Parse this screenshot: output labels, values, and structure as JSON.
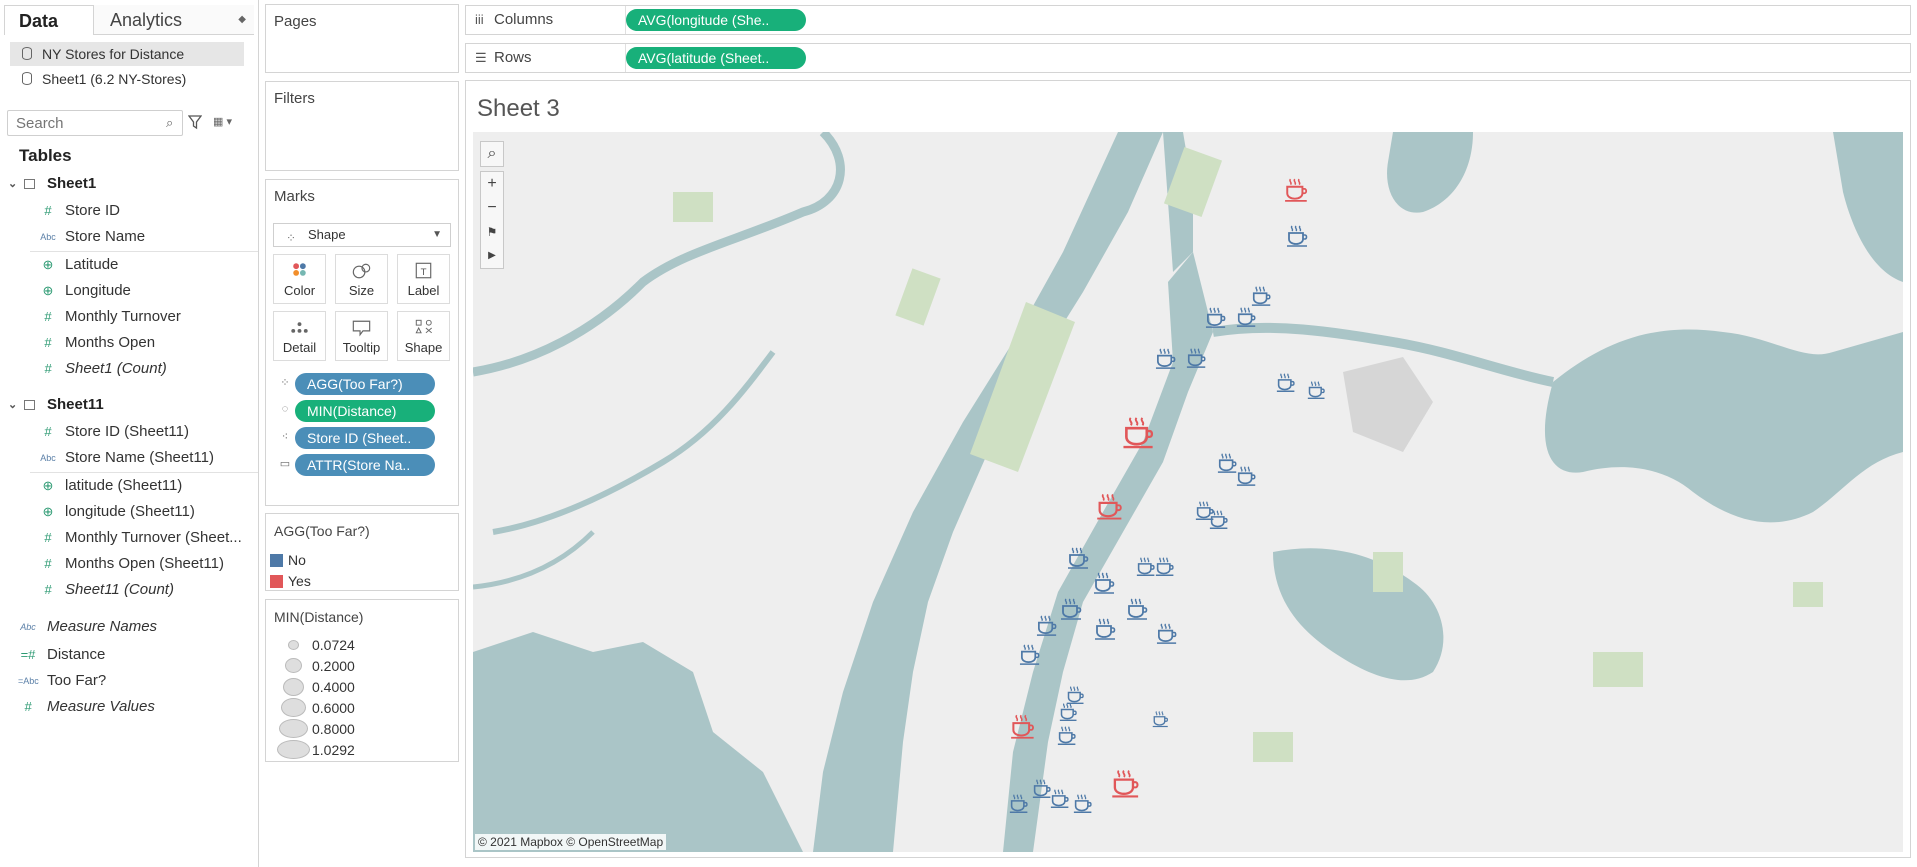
{
  "left_pane": {
    "tabs": {
      "data": "Data",
      "analytics": "Analytics"
    },
    "datasources": [
      "NY Stores for Distance",
      "Sheet1 (6.2 NY-Stores)"
    ],
    "search_placeholder": "Search",
    "tables_header": "Tables",
    "sheet1": {
      "name": "Sheet1",
      "fields": [
        "Store ID",
        "Store Name",
        "Latitude",
        "Longitude",
        "Monthly Turnover",
        "Months Open",
        "Sheet1 (Count)"
      ]
    },
    "sheet11": {
      "name": "Sheet11",
      "fields": [
        "Store ID (Sheet11)",
        "Store Name (Sheet11)",
        "latitude (Sheet11)",
        "longitude (Sheet11)",
        "Monthly Turnover (Sheet...",
        "Months Open (Sheet11)",
        "Sheet11 (Count)"
      ]
    },
    "extra_fields": [
      "Measure Names",
      "Distance",
      "Too Far?",
      "Measure Values"
    ]
  },
  "pages_card": {
    "title": "Pages"
  },
  "filters_card": {
    "title": "Filters"
  },
  "marks": {
    "title": "Marks",
    "mark_type": "Shape",
    "buttons": [
      "Color",
      "Size",
      "Label",
      "Detail",
      "Tooltip",
      "Shape"
    ],
    "pills": [
      "AGG(Too Far?)",
      "MIN(Distance)",
      "Store ID (Sheet..",
      "ATTR(Store Na.."
    ]
  },
  "color_legend": {
    "title": "AGG(Too Far?)",
    "items": [
      {
        "label": "No",
        "color": "#4e79a7"
      },
      {
        "label": "Yes",
        "color": "#e15759"
      }
    ]
  },
  "size_legend": {
    "title": "MIN(Distance)",
    "items": [
      "0.0724",
      "0.2000",
      "0.4000",
      "0.6000",
      "0.8000",
      "1.0292"
    ]
  },
  "shelves": {
    "columns_label": "Columns",
    "columns_pill": "AVG(longitude (She..",
    "rows_label": "Rows",
    "rows_pill": "AVG(latitude (Sheet.."
  },
  "sheet": {
    "title": "Sheet 3",
    "attribution": "© 2021 Mapbox © OpenStreetMap"
  },
  "map_marks": [
    {
      "lon": 0.576,
      "lat": 0.08,
      "too_far": true,
      "size": 0.55
    },
    {
      "lon": 0.577,
      "lat": 0.144,
      "too_far": false,
      "size": 0.45
    },
    {
      "lon": 0.552,
      "lat": 0.228,
      "too_far": false,
      "size": 0.35
    },
    {
      "lon": 0.52,
      "lat": 0.257,
      "too_far": false,
      "size": 0.4
    },
    {
      "lon": 0.541,
      "lat": 0.257,
      "too_far": false,
      "size": 0.35
    },
    {
      "lon": 0.485,
      "lat": 0.314,
      "too_far": false,
      "size": 0.4
    },
    {
      "lon": 0.506,
      "lat": 0.314,
      "too_far": false,
      "size": 0.35
    },
    {
      "lon": 0.569,
      "lat": 0.348,
      "too_far": false,
      "size": 0.3
    },
    {
      "lon": 0.59,
      "lat": 0.358,
      "too_far": false,
      "size": 0.25
    },
    {
      "lon": 0.466,
      "lat": 0.417,
      "too_far": true,
      "size": 0.95
    },
    {
      "lon": 0.528,
      "lat": 0.46,
      "too_far": false,
      "size": 0.35
    },
    {
      "lon": 0.541,
      "lat": 0.478,
      "too_far": false,
      "size": 0.35
    },
    {
      "lon": 0.446,
      "lat": 0.52,
      "too_far": true,
      "size": 0.7
    },
    {
      "lon": 0.512,
      "lat": 0.525,
      "too_far": false,
      "size": 0.3
    },
    {
      "lon": 0.522,
      "lat": 0.538,
      "too_far": false,
      "size": 0.3
    },
    {
      "lon": 0.424,
      "lat": 0.591,
      "too_far": false,
      "size": 0.45
    },
    {
      "lon": 0.471,
      "lat": 0.603,
      "too_far": false,
      "size": 0.3
    },
    {
      "lon": 0.484,
      "lat": 0.603,
      "too_far": false,
      "size": 0.3
    },
    {
      "lon": 0.442,
      "lat": 0.627,
      "too_far": false,
      "size": 0.45
    },
    {
      "lon": 0.465,
      "lat": 0.663,
      "too_far": false,
      "size": 0.45
    },
    {
      "lon": 0.419,
      "lat": 0.663,
      "too_far": false,
      "size": 0.45
    },
    {
      "lon": 0.402,
      "lat": 0.685,
      "too_far": false,
      "size": 0.4
    },
    {
      "lon": 0.443,
      "lat": 0.69,
      "too_far": false,
      "size": 0.45
    },
    {
      "lon": 0.486,
      "lat": 0.697,
      "too_far": false,
      "size": 0.4
    },
    {
      "lon": 0.39,
      "lat": 0.725,
      "too_far": false,
      "size": 0.4
    },
    {
      "lon": 0.422,
      "lat": 0.782,
      "too_far": false,
      "size": 0.25
    },
    {
      "lon": 0.417,
      "lat": 0.805,
      "too_far": false,
      "size": 0.25
    },
    {
      "lon": 0.481,
      "lat": 0.815,
      "too_far": false,
      "size": 0.2
    },
    {
      "lon": 0.385,
      "lat": 0.825,
      "too_far": true,
      "size": 0.6
    },
    {
      "lon": 0.416,
      "lat": 0.838,
      "too_far": false,
      "size": 0.3
    },
    {
      "lon": 0.457,
      "lat": 0.905,
      "too_far": true,
      "size": 0.75
    },
    {
      "lon": 0.398,
      "lat": 0.912,
      "too_far": false,
      "size": 0.3
    },
    {
      "lon": 0.411,
      "lat": 0.925,
      "too_far": false,
      "size": 0.3
    },
    {
      "lon": 0.382,
      "lat": 0.932,
      "too_far": false,
      "size": 0.3
    },
    {
      "lon": 0.427,
      "lat": 0.932,
      "too_far": false,
      "size": 0.3
    }
  ],
  "colors": {
    "pill_blue": "#4b8eb8",
    "pill_green": "#18b07a",
    "water": "#aac5c7",
    "park": "#cfe0c3",
    "land": "#eeeeee"
  }
}
